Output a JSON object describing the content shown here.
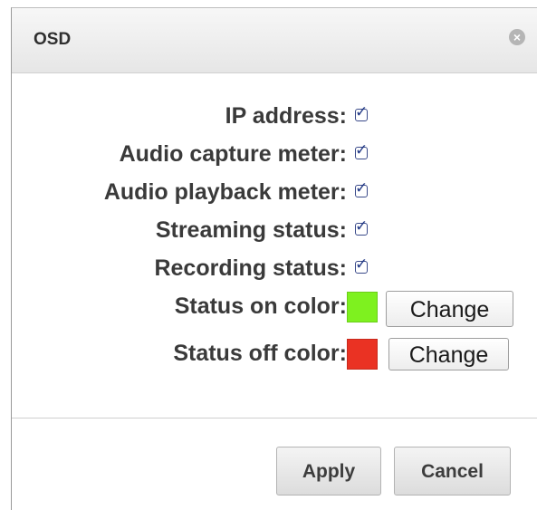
{
  "dialog": {
    "title": "OSD",
    "close_icon": "close-icon"
  },
  "options": [
    {
      "label": "IP address:",
      "checked": true
    },
    {
      "label": "Audio capture meter:",
      "checked": true
    },
    {
      "label": "Audio playback meter:",
      "checked": true
    },
    {
      "label": "Streaming status:",
      "checked": true
    },
    {
      "label": "Recording status:",
      "checked": true
    }
  ],
  "colors": [
    {
      "label": "Status on color:",
      "color": "#7ef11f",
      "button_label": "Change"
    },
    {
      "label": "Status off color:",
      "color": "#ea3223",
      "button_label": "Change"
    }
  ],
  "footer": {
    "apply_label": "Apply",
    "cancel_label": "Cancel"
  }
}
